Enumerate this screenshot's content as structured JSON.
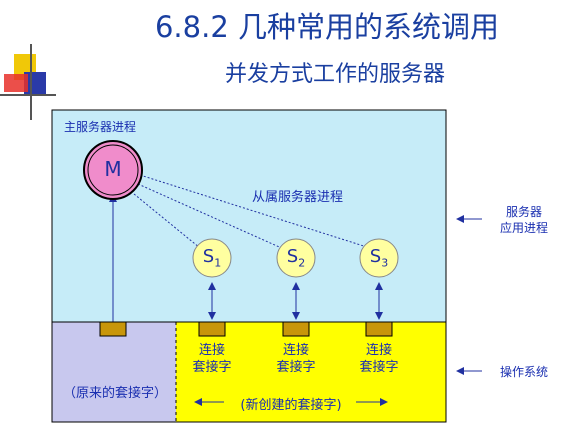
{
  "title": {
    "main": "6.8.2  几种常用的系统调用",
    "sub": "并发方式工作的服务器"
  },
  "diagram": {
    "master_process_label": "主服务器进程",
    "master_node": "M",
    "slave_process_label": "从属服务器进程",
    "slaves": [
      {
        "base": "S",
        "sub": "1"
      },
      {
        "base": "S",
        "sub": "2"
      },
      {
        "base": "S",
        "sub": "3"
      }
    ],
    "connection_socket_label": {
      "line1": "连接",
      "line2": "套接字"
    },
    "original_socket_label": "（原来的套接字）",
    "new_socket_label": "(新创建的套接字)"
  },
  "side_labels": {
    "app_process": {
      "line1": "服务器",
      "line2": "应用进程"
    },
    "os": "操作系统"
  },
  "colors": {
    "app_region": "#c6ecf8",
    "os_left": "#c8c8ee",
    "os_right": "#ffff00",
    "master_fill": "#f08ccb",
    "slave_fill": "#ffffa0",
    "socket_fill": "#c8960a",
    "arrow": "#2030a0"
  }
}
